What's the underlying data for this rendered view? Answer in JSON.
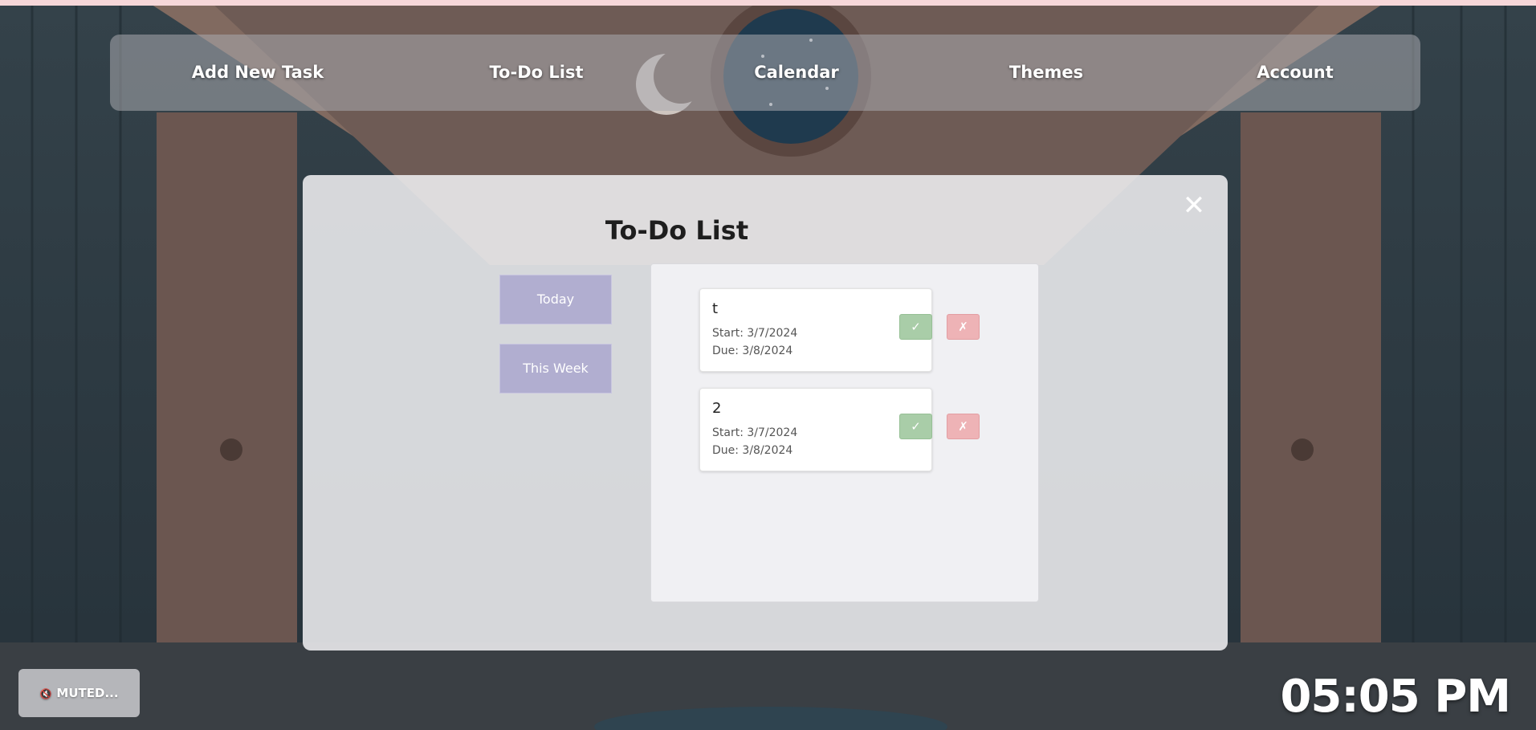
{
  "app": {
    "nav": [
      {
        "label": "Add New Task"
      },
      {
        "label": "To-Do List"
      },
      {
        "label": "Calendar"
      },
      {
        "label": "Themes"
      },
      {
        "label": "Account"
      }
    ]
  },
  "modal": {
    "title": "To-Do List",
    "close_icon": "close-icon",
    "filters": [
      {
        "label": "Today"
      },
      {
        "label": "This Week"
      }
    ],
    "tasks": [
      {
        "title": "t",
        "start": "Start: 3/7/2024",
        "due": "Due: 3/8/2024",
        "done_label": "✓",
        "delete_label": "✗"
      },
      {
        "title": "2",
        "start": "Start: 3/7/2024",
        "due": "Due: 3/8/2024",
        "done_label": "✓",
        "delete_label": "✗"
      }
    ]
  },
  "footer": {
    "mute_label": "MUTED...",
    "mute_icon": "speaker-muted-icon",
    "clock": "05:05 PM"
  },
  "colors": {
    "accent_lavender": "#b1aed0",
    "done_green": "#a9cda8",
    "delete_pink": "#eeb3b6"
  }
}
